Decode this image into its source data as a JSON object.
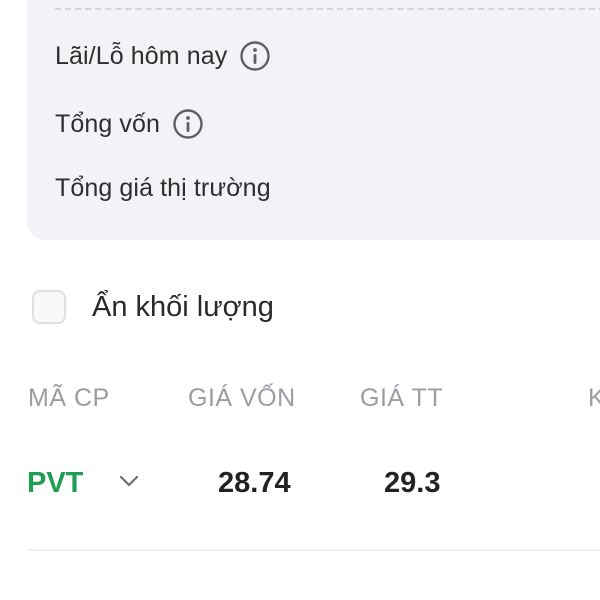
{
  "summary": {
    "today_pnl_label": "Lãi/Lỗ hôm nay",
    "total_capital_label": "Tổng vốn",
    "total_market_value_label": "Tổng giá thị trường"
  },
  "options": {
    "hide_volume_label": "Ẩn khối lượng",
    "hide_volume_checked": false
  },
  "table": {
    "headers": [
      "MÃ CP",
      "GIÁ VỐN",
      "GIÁ TT",
      "K"
    ],
    "rows": [
      {
        "symbol": "PVT",
        "cost_price": "28.74",
        "market_price": "29.3"
      }
    ]
  },
  "colors": {
    "symbol_green": "#1f9d55",
    "card_bg": "#f2f3f6",
    "header_gray": "#9a9da3"
  },
  "icons": {
    "info": "info-circle-icon",
    "expand": "chevron-down-icon"
  }
}
